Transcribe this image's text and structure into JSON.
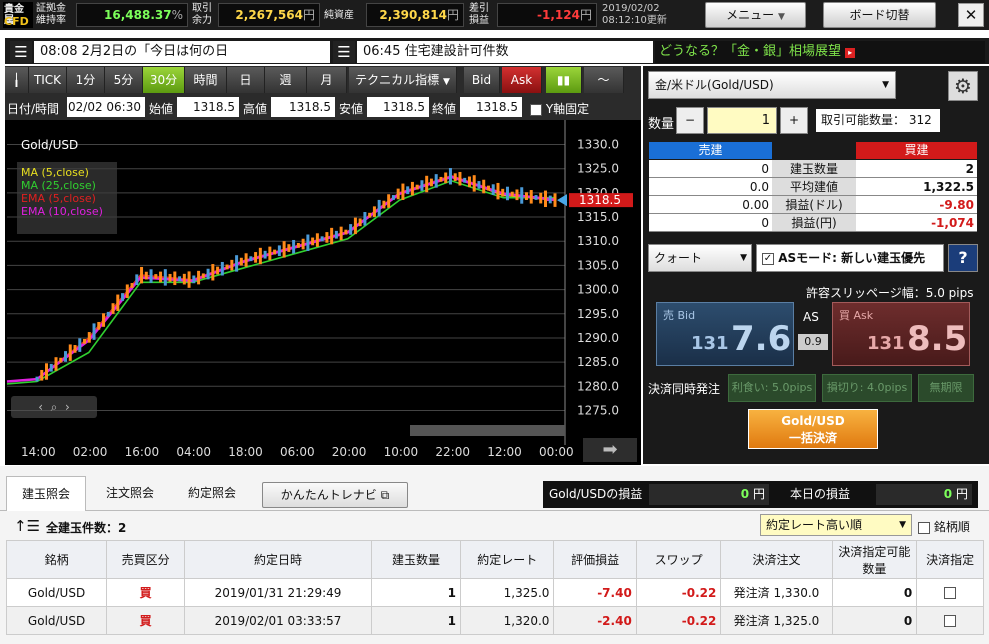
{
  "header": {
    "brand_top": "貴金属",
    "brand_bottom": "CFD",
    "margin_label_top": "証拠金",
    "margin_label_bottom": "維持率",
    "margin_rate": "16,488.37",
    "margin_unit": "%",
    "avail_label_top": "取引",
    "avail_label_bottom": "余力",
    "avail": "2,267,564",
    "avail_unit": "円",
    "net_assets_label": "純資産",
    "net_assets": "2,390,814",
    "net_assets_unit": "円",
    "pl_label_top": "差引",
    "pl_label_bottom": "損益",
    "pl": "-1,124",
    "pl_unit": "円",
    "date": "2019/02/02",
    "updated": "08:12:10更新",
    "menu_label": "メニュー",
    "board_label": "ボード切替",
    "close_label": "✕"
  },
  "news": {
    "item1": "08:08 2月2日の「今日は何の日",
    "item2": "06:45 住宅建設計可件数",
    "promo": "どうなる？「金・銀」相場展望"
  },
  "toolbar": {
    "tick": "TICK",
    "m1": "1分",
    "m5": "5分",
    "m30": "30分",
    "hour": "時間",
    "day": "日",
    "week": "週",
    "month": "月",
    "technical": "テクニカル指標",
    "bid": "Bid",
    "ask": "Ask"
  },
  "ohlc": {
    "datetime_label": "日付/時間",
    "datetime": "02/02 06:30",
    "open_label": "始値",
    "open": "1318.5",
    "high_label": "高値",
    "high": "1318.5",
    "low_label": "安値",
    "low": "1318.5",
    "close_label": "終値",
    "close": "1318.5",
    "yfix_label": "Y軸固定"
  },
  "chart": {
    "symbol": "Gold/USD",
    "legend": [
      {
        "name": "MA (5,close)",
        "color": "#e8e020"
      },
      {
        "name": "MA (25,close)",
        "color": "#30d030"
      },
      {
        "name": "EMA (5,close)",
        "color": "#e02020"
      },
      {
        "name": "EMA (10,close)",
        "color": "#e020e0"
      }
    ],
    "current_price": "1318.5",
    "y_ticks": [
      "1330.0",
      "1325.0",
      "1320.0",
      "1315.0",
      "1310.0",
      "1305.0",
      "1300.0",
      "1295.0",
      "1290.0",
      "1285.0",
      "1280.0",
      "1275.0"
    ],
    "x_ticks": [
      "14:00",
      "02:00",
      "16:00",
      "04:00",
      "18:00",
      "06:00",
      "20:00",
      "10:00",
      "22:00",
      "12:00",
      "00:00"
    ]
  },
  "chart_data": {
    "type": "line",
    "title": "Gold/USD",
    "x": [
      "14:00",
      "02:00",
      "16:00",
      "04:00",
      "18:00",
      "06:00",
      "20:00",
      "10:00",
      "22:00",
      "12:00",
      "00:00"
    ],
    "series": [
      {
        "name": "MA (5,close)",
        "values": [
          1281.5,
          1290,
          1303,
          1302,
          1306,
          1309,
          1312,
          1320,
          1323.5,
          1319.5,
          1318.5
        ]
      },
      {
        "name": "MA (25,close)",
        "values": [
          1281,
          1287,
          1301.5,
          1301.5,
          1304.5,
          1307.5,
          1310.5,
          1318.5,
          1322.5,
          1319,
          1319
        ]
      },
      {
        "name": "EMA (5,close)",
        "values": [
          1281.5,
          1290,
          1303,
          1302,
          1306,
          1309,
          1312,
          1320,
          1323.5,
          1320,
          1318.5
        ]
      },
      {
        "name": "EMA (10,close)",
        "values": [
          1281.5,
          1289.5,
          1302.5,
          1301.8,
          1305.8,
          1308.8,
          1311.8,
          1319.8,
          1323.3,
          1319.8,
          1318.6
        ]
      }
    ],
    "ylim": [
      1272,
      1333
    ],
    "ylabel": "",
    "xlabel": ""
  },
  "order": {
    "symbol": "金/米ドル(Gold/USD)",
    "qty_label": "数量",
    "qty": "1",
    "minus": "−",
    "plus": "+",
    "tradable_label": "取引可能数量：",
    "tradable": "312",
    "sell_header": "売建",
    "buy_header": "買建",
    "rows": [
      {
        "left": "0",
        "label": "建玉数量",
        "right": "2"
      },
      {
        "left": "0.0",
        "label": "平均建値",
        "right": "1,322.5"
      },
      {
        "left": "0.00",
        "label": "損益(ドル)",
        "right": "-9.80"
      },
      {
        "left": "0",
        "label": "損益(円)",
        "right": "-1,074"
      }
    ],
    "order_type": "クォート",
    "as_mode": "ASモード: 新しい建玉優先",
    "help": "?",
    "slippage": "許容スリッページ幅：5.0 pips",
    "bid_label": "売 Bid",
    "bid_big": "131",
    "bid_small": "7.6",
    "ask_label": "買 Ask",
    "ask_big": "131",
    "ask_small": "8.5",
    "as_label": "AS",
    "spread": "0.9",
    "settle_label": "決済同時発注",
    "take_profit": "利食い: 5.0pips",
    "stop_loss": "損切り: 4.0pips",
    "unlimited": "無期限",
    "bulk_top": "Gold/USD",
    "bulk_bottom": "一括決済"
  },
  "positions": {
    "tab1": "建玉照会",
    "tab2": "注文照会",
    "tab3": "約定照会",
    "navi": "かんたんトレナビ",
    "pl_label": "Gold/USDの損益",
    "pl_value": "0",
    "pl_unit": "円",
    "today_label": "本日の損益",
    "today_value": "0",
    "today_unit": "円",
    "count_label": "全建玉件数：2",
    "sort": "約定レート高い順",
    "brand_sort": "銘柄順",
    "columns": [
      "銘柄",
      "売買区分",
      "約定日時",
      "建玉数量",
      "約定レート",
      "評価損益",
      "スワップ",
      "決済注文",
      "決済指定可能数量",
      "決済指定"
    ],
    "rows": [
      {
        "symbol": "Gold/USD",
        "side": "買",
        "datetime": "2019/01/31 21:29:49",
        "qty": "1",
        "rate": "1,325.0",
        "pl": "-7.40",
        "swap": "-0.22",
        "order": "発注済 1,330.0",
        "avail": "0"
      },
      {
        "symbol": "Gold/USD",
        "side": "買",
        "datetime": "2019/02/01 03:33:57",
        "qty": "1",
        "rate": "1,320.0",
        "pl": "-2.40",
        "swap": "-0.22",
        "order": "発注済 1,325.0",
        "avail": "0"
      }
    ]
  },
  "colors": {
    "positive": "#7cff5a",
    "negative": "#ff3b3b",
    "sell": "#1a6fd6",
    "buy": "#d21a1a",
    "accent": "#f29a1a"
  }
}
